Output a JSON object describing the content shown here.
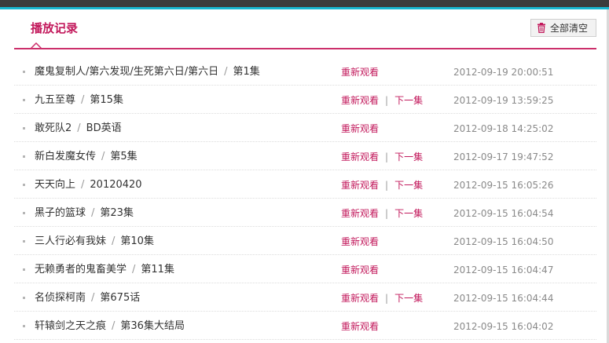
{
  "header": {
    "title": "播放记录",
    "clear_all_label": "全部清空"
  },
  "history": [
    {
      "show": "魔鬼复制人/第六发现/生死第六日/第六日",
      "episode": "第1集",
      "rewatch": "重新观看",
      "next": "",
      "time": "2012-09-19 20:00:51"
    },
    {
      "show": "九五至尊",
      "episode": "第15集",
      "rewatch": "重新观看",
      "next": "下一集",
      "time": "2012-09-19 13:59:25"
    },
    {
      "show": "敢死队2",
      "episode": "BD英语",
      "rewatch": "重新观看",
      "next": "",
      "time": "2012-09-18 14:25:02"
    },
    {
      "show": "新白发魔女传",
      "episode": "第5集",
      "rewatch": "重新观看",
      "next": "下一集",
      "time": "2012-09-17 19:47:52"
    },
    {
      "show": "天天向上",
      "episode": "20120420",
      "rewatch": "重新观看",
      "next": "下一集",
      "time": "2012-09-15 16:05:26"
    },
    {
      "show": "黑子的篮球",
      "episode": "第23集",
      "rewatch": "重新观看",
      "next": "下一集",
      "time": "2012-09-15 16:04:54"
    },
    {
      "show": "三人行必有我妹",
      "episode": "第10集",
      "rewatch": "重新观看",
      "next": "",
      "time": "2012-09-15 16:04:50"
    },
    {
      "show": "无赖勇者的鬼畜美学",
      "episode": "第11集",
      "rewatch": "重新观看",
      "next": "",
      "time": "2012-09-15 16:04:47"
    },
    {
      "show": "名侦探柯南",
      "episode": "第675话",
      "rewatch": "重新观看",
      "next": "下一集",
      "time": "2012-09-15 16:04:44"
    },
    {
      "show": "轩辕剑之天之痕",
      "episode": "第36集大结局",
      "rewatch": "重新观看",
      "next": "",
      "time": "2012-09-15 16:04:02"
    }
  ],
  "colors": {
    "accent": "#c2185b",
    "top_bar": "#3b3b3b",
    "top_line": "#18b6cf"
  },
  "icons": {
    "clear_all": "trash-icon"
  }
}
